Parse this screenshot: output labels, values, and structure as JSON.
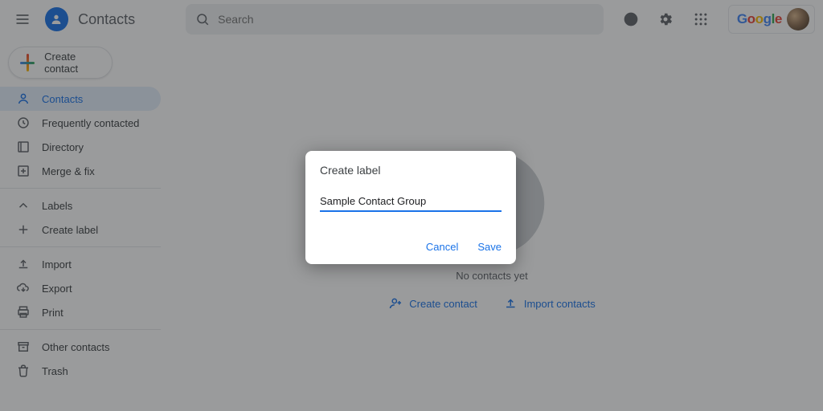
{
  "header": {
    "app_name": "Contacts",
    "search_placeholder": "Search",
    "google_word": "Google"
  },
  "sidebar": {
    "create_label": "Create contact",
    "items_a": [
      {
        "icon": "person",
        "label": "Contacts",
        "active": true
      },
      {
        "icon": "history",
        "label": "Frequently contacted",
        "active": false
      },
      {
        "icon": "directory",
        "label": "Directory",
        "active": false
      },
      {
        "icon": "merge",
        "label": "Merge & fix",
        "active": false
      }
    ],
    "labels_header": {
      "icon": "chevron-up",
      "label": "Labels"
    },
    "create_label_item": {
      "icon": "plus",
      "label": "Create label"
    },
    "items_b": [
      {
        "icon": "upload",
        "label": "Import"
      },
      {
        "icon": "cloud-down",
        "label": "Export"
      },
      {
        "icon": "print",
        "label": "Print"
      }
    ],
    "items_c": [
      {
        "icon": "archive",
        "label": "Other contacts"
      },
      {
        "icon": "trash",
        "label": "Trash"
      }
    ]
  },
  "main": {
    "empty_text": "No contacts yet",
    "create_contact": "Create contact",
    "import_contacts": "Import contacts"
  },
  "dialog": {
    "title": "Create label",
    "value": "Sample Contact Group",
    "cancel": "Cancel",
    "save": "Save"
  }
}
